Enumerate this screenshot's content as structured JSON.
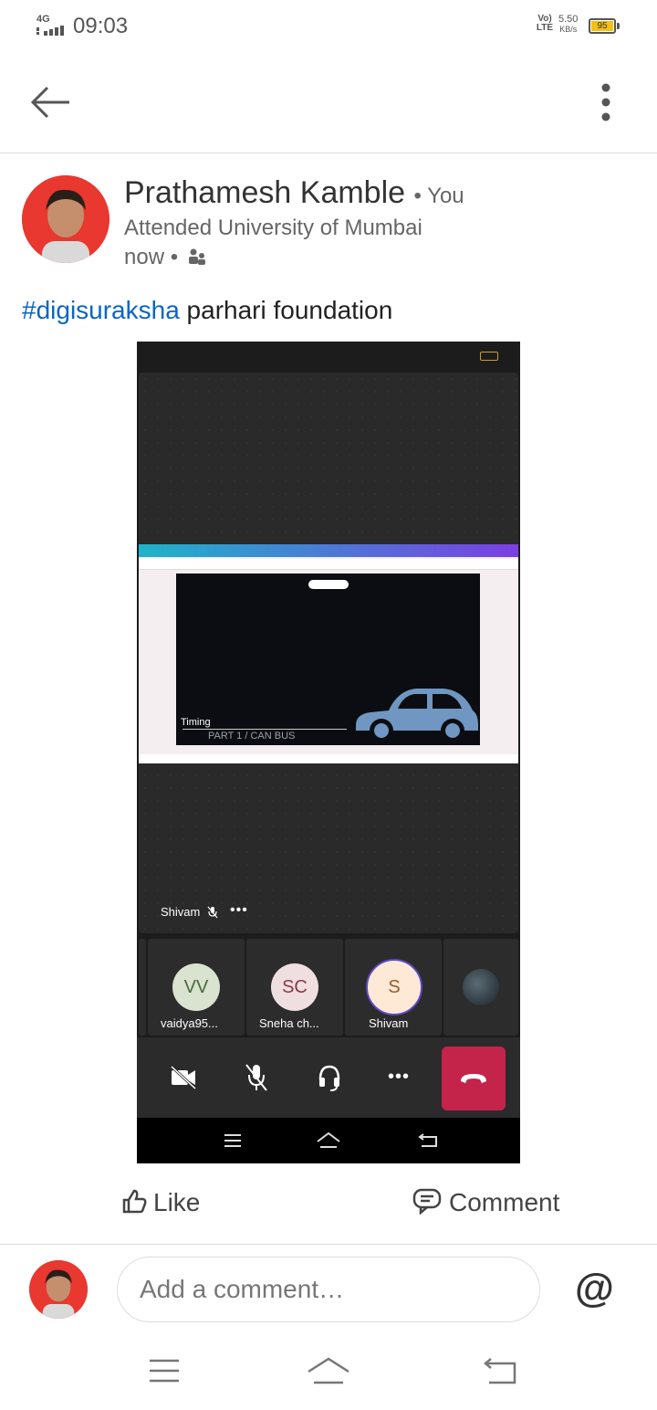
{
  "status_bar": {
    "network": "4G",
    "time": "09:03",
    "volte": "Vo) LTE",
    "speed_value": "5.50",
    "speed_unit": "KB/s",
    "battery": "95"
  },
  "toolbar": {
    "back_icon": "arrow-left-icon",
    "more_icon": "more-vertical-icon"
  },
  "post": {
    "author": "Prathamesh Kamble",
    "you_badge": "• You",
    "headline": "Attended University of Mumbai",
    "time": "now •",
    "visibility_icon": "connections-icon",
    "hashtag": "#digisuraksha",
    "text": " parhari foundation"
  },
  "meeting": {
    "slide_title": "Timing",
    "slide_subtitle": "PART 1 / CAN BUS",
    "presenter_name": "Shivam",
    "participants": [
      {
        "initials": "VV",
        "name": "vaidya95..."
      },
      {
        "initials": "SC",
        "name": "Sneha ch..."
      },
      {
        "initials": "S",
        "name": "Shivam"
      }
    ]
  },
  "actions": {
    "like_label": "Like",
    "comment_label": "Comment"
  },
  "comment_box": {
    "placeholder": "Add a comment…"
  },
  "colors": {
    "hashtag": "#0a66c2",
    "end_call": "#c4244a",
    "avatar_bg": "#e8382f"
  }
}
